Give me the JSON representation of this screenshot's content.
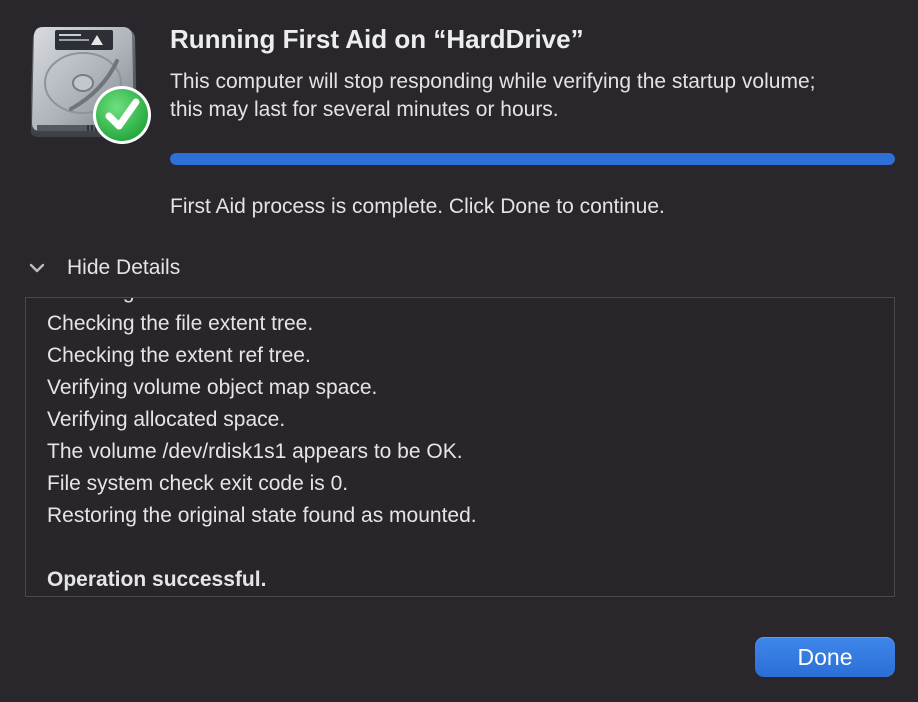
{
  "dialog": {
    "title": "Running First Aid on “HardDrive”",
    "message": "This computer will stop responding while verifying the startup volume; this may last for several minutes or hours.",
    "progress_fraction": 1.0,
    "status": "First Aid process is complete. Click Done to continue.",
    "details_toggle_label": "Hide Details",
    "done_label": "Done",
    "accent_color": "#2f70d8",
    "success_color": "#34c759"
  },
  "log": {
    "lines": [
      {
        "text": "Checking the fsroot tree.",
        "bold": false
      },
      {
        "text": "Checking the file extent tree.",
        "bold": false
      },
      {
        "text": "Checking the extent ref tree.",
        "bold": false
      },
      {
        "text": "Verifying volume object map space.",
        "bold": false
      },
      {
        "text": "Verifying allocated space.",
        "bold": false
      },
      {
        "text": "The volume /dev/rdisk1s1 appears to be OK.",
        "bold": false
      },
      {
        "text": "File system check exit code is 0.",
        "bold": false
      },
      {
        "text": "Restoring the original state found as mounted.",
        "bold": false
      },
      {
        "text": "",
        "bold": false
      },
      {
        "text": "Operation successful.",
        "bold": true
      }
    ]
  },
  "icons": {
    "drive": "hard-drive-icon",
    "success": "checkmark-badge-icon",
    "toggle": "chevron-down-icon"
  }
}
